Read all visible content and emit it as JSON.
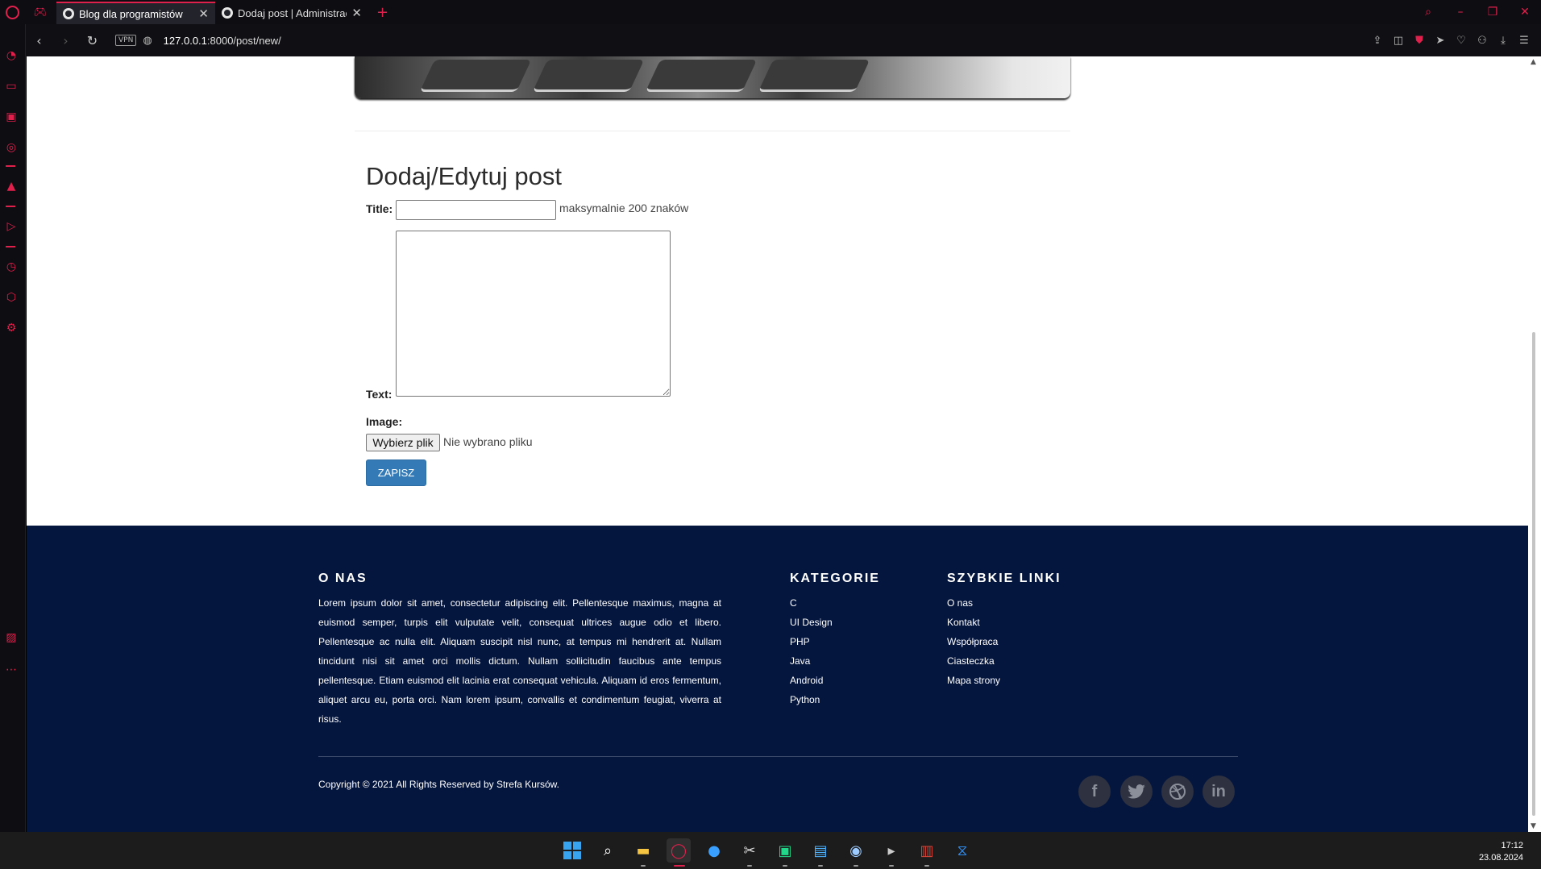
{
  "browser": {
    "tabs": [
      {
        "title": "Blog dla programistów",
        "active": true
      },
      {
        "title": "Dodaj post | Administracja",
        "active": false
      }
    ],
    "new_tab_symbol": "+",
    "close_symbol": "✕",
    "vpn_label": "VPN",
    "url_host": "127.0.0.1",
    "url_rest": ":8000/post/new/",
    "accent_color": "#e0204c"
  },
  "form": {
    "heading": "Dodaj/Edytuj post",
    "title_label": "Title:",
    "title_value": "",
    "title_help": "maksymalnie 200 znaków",
    "text_label": "Text:",
    "text_value": "",
    "image_label": "Image:",
    "file_button": "Wybierz plik",
    "file_status": "Nie wybrano pliku",
    "submit_label": "ZAPISZ",
    "submit_color": "#337ab7"
  },
  "footer": {
    "background": "#05163e",
    "about_heading": "O NAS",
    "about_text": "Lorem ipsum dolor sit amet, consectetur adipiscing elit. Pellentesque maximus, magna at euismod semper, turpis elit vulputate velit, consequat ultrices augue odio et libero. Pellentesque ac nulla elit. Aliquam suscipit nisl nunc, at tempus mi hendrerit at. Nullam tincidunt nisi sit amet orci mollis dictum. Nullam sollicitudin faucibus ante tempus pellentesque. Etiam euismod elit lacinia erat consequat vehicula. Aliquam id eros fermentum, aliquet arcu eu, porta orci. Nam lorem ipsum, convallis et condimentum feugiat, viverra at risus.",
    "categories_heading": "KATEGORIE",
    "categories": [
      "C",
      "UI Design",
      "PHP",
      "Java",
      "Android",
      "Python"
    ],
    "links_heading": "SZYBKIE LINKI",
    "links": [
      "O nas",
      "Kontakt",
      "Współpraca",
      "Ciasteczka",
      "Mapa strony"
    ],
    "copyright": "Copyright © 2021 All Rights Reserved by Strefa Kursów.",
    "social_icons": [
      "facebook-icon",
      "twitter-icon",
      "dribbble-icon",
      "linkedin-icon"
    ]
  },
  "taskbar": {
    "time": "17:12",
    "date": "23.08.2024"
  }
}
